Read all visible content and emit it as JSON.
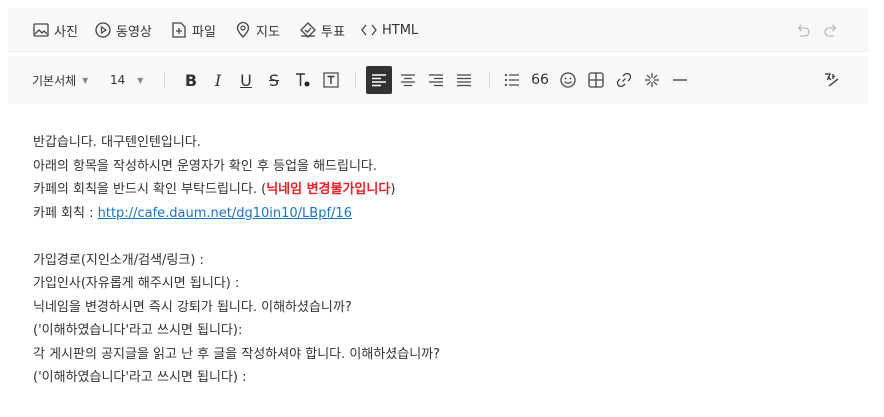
{
  "insert_toolbar": {
    "photo": "사진",
    "video": "동영상",
    "file": "파일",
    "map": "지도",
    "vote": "투표",
    "html": "HTML"
  },
  "format_toolbar": {
    "font_family": "기본서체",
    "font_size": "14",
    "bold": "B",
    "italic": "I",
    "underline": "U",
    "strike": "S",
    "quote": "66"
  },
  "content": {
    "line1": "반갑습니다. 대구텐인텐입니다.",
    "line2": "아래의 항목을 작성하시면 운영자가 확인 후 등업을 해드립니다.",
    "line3_prefix": "카페의 회칙을 반드시 확인 부탁드립니다. (",
    "line3_red": "닉네임 변경불가입니다",
    "line3_suffix": ")",
    "line4_label": "카페 회칙 : ",
    "line4_link": "http://cafe.daum.net/dg10in10/LBpf/16",
    "line6": "가입경로(지인소개/검색/링크) :",
    "line7": "가입인사(자유롭게 해주시면 됩니다) :",
    "line8": "닉네임을 변경하시면 즉시 강퇴가 됩니다. 이해하셨습니까?",
    "line9": "('이해하였습니다'라고 쓰시면 됩니다):",
    "line10": "각 게시판의 공지글을 읽고 난 후 글을 작성하셔야 합니다. 이해하셨습니까?",
    "line11": "('이해하였습니다'라고 쓰시면 됩니다) :"
  }
}
